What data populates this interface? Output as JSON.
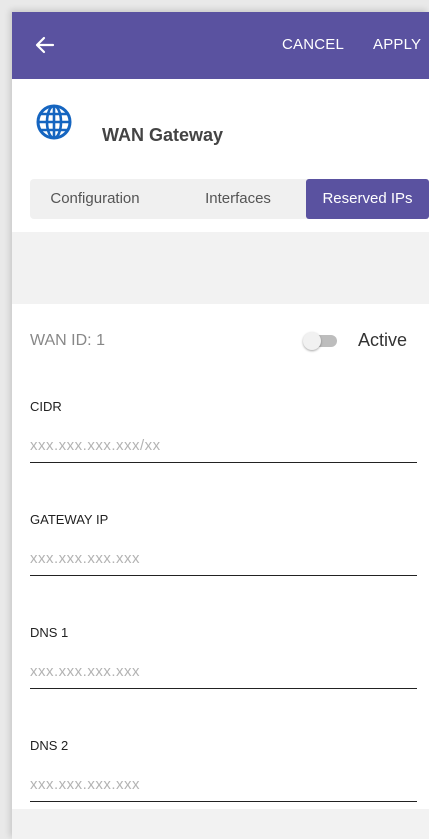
{
  "topbar": {
    "back_icon": "arrow-left-icon",
    "cancel_label": "CANCEL",
    "apply_label": "APPLY",
    "color": "#5a52a0"
  },
  "header": {
    "icon": "globe-icon",
    "icon_color": "#1565c0",
    "title": "WAN Gateway"
  },
  "tabs": [
    {
      "label": "Configuration",
      "selected": false
    },
    {
      "label": "Interfaces",
      "selected": false
    },
    {
      "label": "Reserved IPs",
      "selected": true
    }
  ],
  "form": {
    "wan_id": "WAN ID: 1",
    "active_label": "Active",
    "active_on": false,
    "fields": [
      {
        "label": "CIDR",
        "value": "",
        "placeholder": "xxx.xxx.xxx.xxx/xx"
      },
      {
        "label": "GATEWAY IP",
        "value": "",
        "placeholder": "xxx.xxx.xxx.xxx"
      },
      {
        "label": "DNS 1",
        "value": "",
        "placeholder": "xxx.xxx.xxx.xxx"
      },
      {
        "label": "DNS 2",
        "value": "",
        "placeholder": "xxx.xxx.xxx.xxx"
      }
    ]
  }
}
